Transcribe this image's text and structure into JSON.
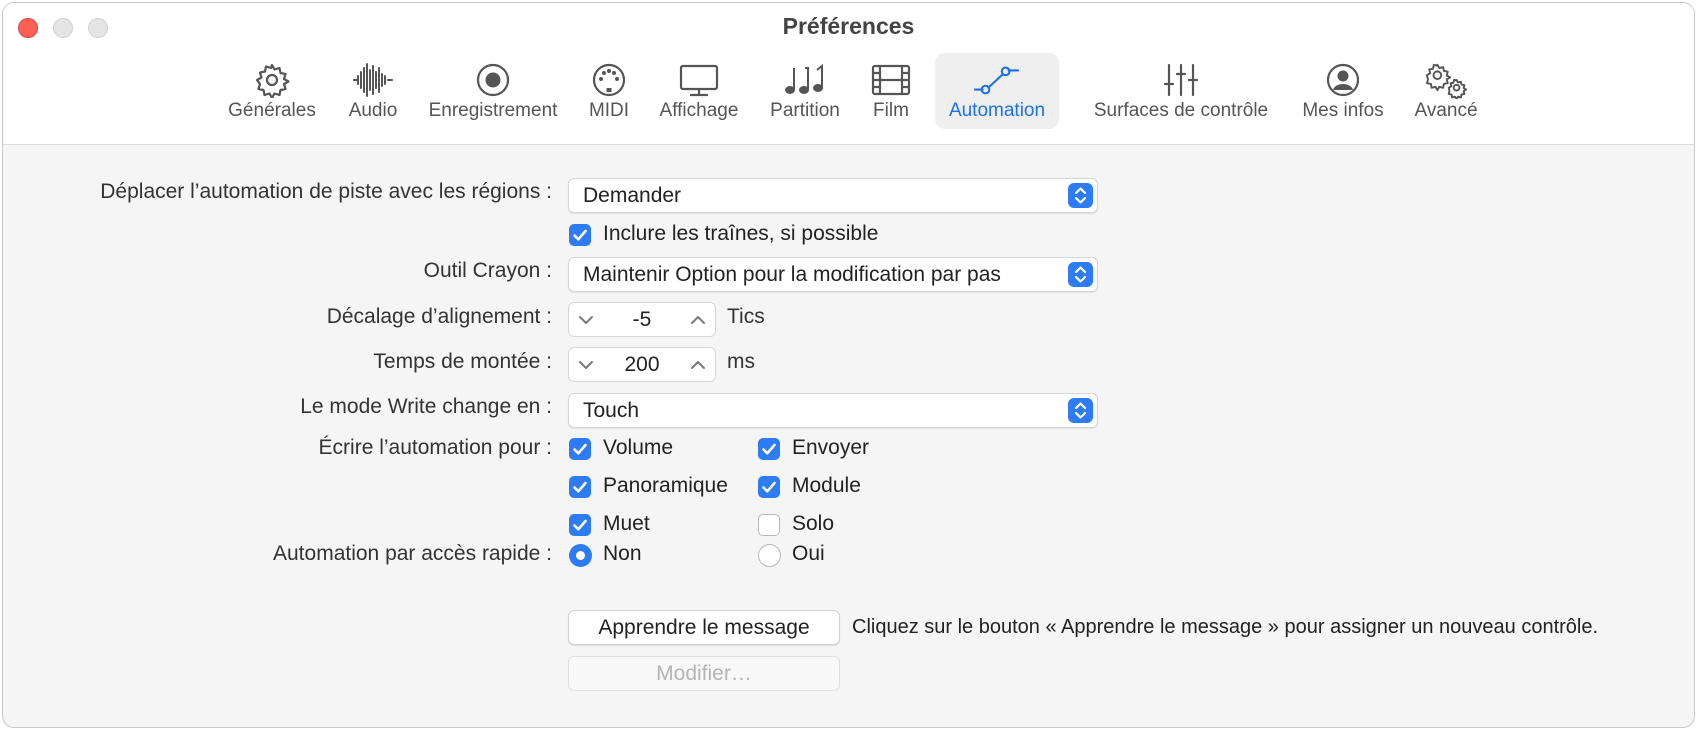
{
  "window": {
    "title": "Préférences"
  },
  "toolbar": {
    "items": [
      {
        "label": "Générales",
        "icon": "gear-icon"
      },
      {
        "label": "Audio",
        "icon": "waveform-icon"
      },
      {
        "label": "Enregistrement",
        "icon": "record-icon"
      },
      {
        "label": "MIDI",
        "icon": "midi-connector-icon"
      },
      {
        "label": "Affichage",
        "icon": "display-icon"
      },
      {
        "label": "Partition",
        "icon": "music-notes-icon"
      },
      {
        "label": "Film",
        "icon": "film-icon"
      },
      {
        "label": "Automation",
        "icon": "automation-curve-icon",
        "selected": true
      },
      {
        "label": "Surfaces de contrôle",
        "icon": "sliders-icon"
      },
      {
        "label": "Mes infos",
        "icon": "person-icon"
      },
      {
        "label": "Avancé",
        "icon": "gears-icon"
      }
    ]
  },
  "form": {
    "move_automation": {
      "label": "Déplacer l’automation de piste avec les régions :",
      "value": "Demander"
    },
    "include_tails": {
      "label": "Inclure les traînes, si possible",
      "checked": true
    },
    "pencil_tool": {
      "label": "Outil Crayon :",
      "value": "Maintenir Option pour la modification par pas"
    },
    "snap_offset": {
      "label": "Décalage d’alignement :",
      "value": "-5",
      "unit": "Tics"
    },
    "ramp_time": {
      "label": "Temps de montée :",
      "value": "200",
      "unit": "ms"
    },
    "write_mode": {
      "label": "Le mode Write change en :",
      "value": "Touch"
    },
    "write_automation_for": {
      "label": "Écrire l’automation pour :",
      "options": [
        {
          "label": "Volume",
          "checked": true
        },
        {
          "label": "Envoyer",
          "checked": true
        },
        {
          "label": "Panoramique",
          "checked": true
        },
        {
          "label": "Module",
          "checked": true
        },
        {
          "label": "Muet",
          "checked": true
        },
        {
          "label": "Solo",
          "checked": false
        }
      ]
    },
    "quick_access": {
      "label": "Automation par accès rapide :",
      "options": [
        {
          "label": "Non",
          "selected": true
        },
        {
          "label": "Oui",
          "selected": false
        }
      ]
    },
    "learn_button": {
      "label": "Apprendre le message"
    },
    "learn_hint": "Cliquez sur le bouton « Apprendre le message » pour assigner un nouveau contrôle.",
    "edit_button": {
      "label": "Modifier…",
      "enabled": false
    }
  },
  "colors": {
    "accent": "#2d7cf6",
    "close": "#ff5f57"
  }
}
